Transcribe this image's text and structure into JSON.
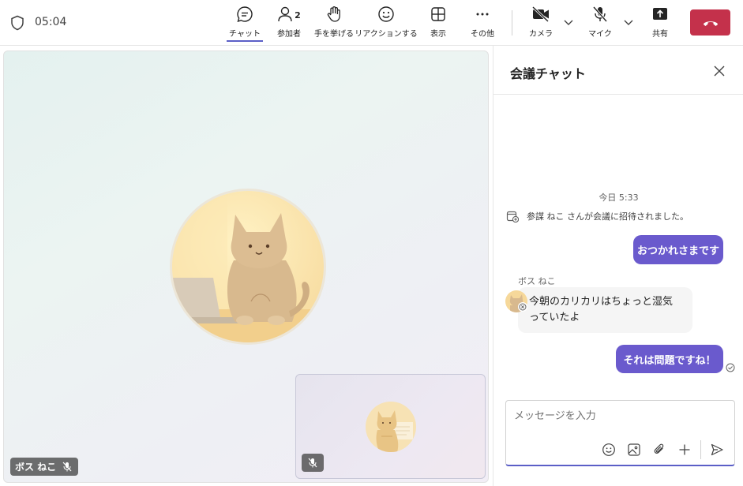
{
  "topbar": {
    "timer": "05:04",
    "buttons": {
      "chat": "チャット",
      "participants": "参加者",
      "participant_count": "2",
      "raise_hand": "手を挙げる",
      "react": "リアクションする",
      "view": "表示",
      "more": "その他",
      "camera": "カメラ",
      "mic": "マイク",
      "share": "共有"
    }
  },
  "stage": {
    "presenter_name": "ボス ねこ"
  },
  "chat": {
    "title": "会議チャット",
    "date_separator": "今日 5:33",
    "system_message": "参謀 ねこ さんが会議に招待されました。",
    "messages": [
      {
        "direction": "out",
        "text": "おつかれさまです"
      },
      {
        "direction": "in",
        "sender": "ボス ねこ",
        "text": "今朝のカリカリはちょっと湿気っていたよ"
      },
      {
        "direction": "out",
        "text": "それは問題ですね！"
      }
    ],
    "compose_placeholder": "メッセージを入力"
  },
  "colors": {
    "accent": "#5b5fc7",
    "bubble_out": "#6a5acd",
    "end_call": "#c4314b"
  }
}
